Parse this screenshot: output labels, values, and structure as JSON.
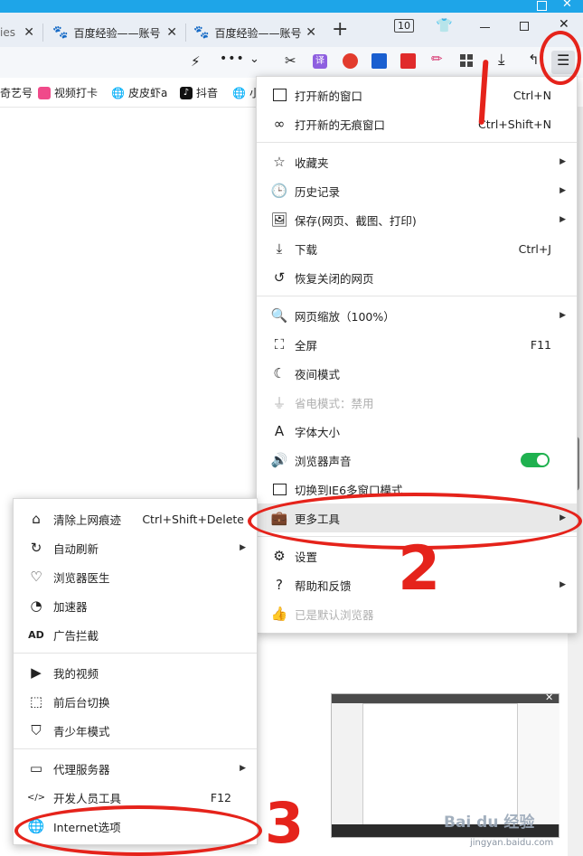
{
  "tabs": [
    {
      "label": "ies"
    },
    {
      "label": "百度经验——账号"
    },
    {
      "label": "百度经验——账号"
    }
  ],
  "tab_count": "10",
  "new_tab": "+",
  "bookmarks": [
    {
      "label": "奇艺号"
    },
    {
      "label": "视频打卡"
    },
    {
      "label": "皮皮虾a"
    },
    {
      "label": "抖音"
    },
    {
      "label": "小"
    }
  ],
  "main_menu": {
    "items": [
      {
        "label": "打开新的窗口",
        "shortcut": "Ctrl+N"
      },
      {
        "label": "打开新的无痕窗口",
        "shortcut": "Ctrl+Shift+N"
      },
      {
        "label": "收藏夹"
      },
      {
        "label": "历史记录"
      },
      {
        "label": "保存(网页、截图、打印)"
      },
      {
        "label": "下载",
        "shortcut": "Ctrl+J"
      },
      {
        "label": "恢复关闭的网页"
      },
      {
        "label": "网页缩放（100%）"
      },
      {
        "label": "全屏",
        "shortcut": "F11"
      },
      {
        "label": "夜间模式"
      },
      {
        "label": "省电模式：禁用"
      },
      {
        "label": "字体大小"
      },
      {
        "label": "浏览器声音",
        "toggle": true
      },
      {
        "label": "切换到IE6多窗口模式"
      },
      {
        "label": "更多工具"
      },
      {
        "label": "设置"
      },
      {
        "label": "帮助和反馈"
      },
      {
        "label": "已是默认浏览器"
      }
    ]
  },
  "sub_menu": {
    "items": [
      {
        "label": "清除上网痕迹",
        "shortcut": "Ctrl+Shift+Delete"
      },
      {
        "label": "自动刷新"
      },
      {
        "label": "浏览器医生"
      },
      {
        "label": "加速器"
      },
      {
        "label": "广告拦截"
      },
      {
        "label": "我的视频"
      },
      {
        "label": "前后台切换"
      },
      {
        "label": "青少年模式"
      },
      {
        "label": "代理服务器"
      },
      {
        "label": "开发人员工具",
        "shortcut": "F12"
      },
      {
        "label": "Internet选项"
      }
    ]
  },
  "annotations": {
    "one": "1",
    "two": "2",
    "three": "3"
  },
  "watermark": {
    "brand": "Bai du 经验",
    "url": "jingyan.baidu.com"
  },
  "colors": {
    "accent": "#1ea5e8",
    "toggle": "#1fb14f",
    "annotation": "#e5231b"
  }
}
